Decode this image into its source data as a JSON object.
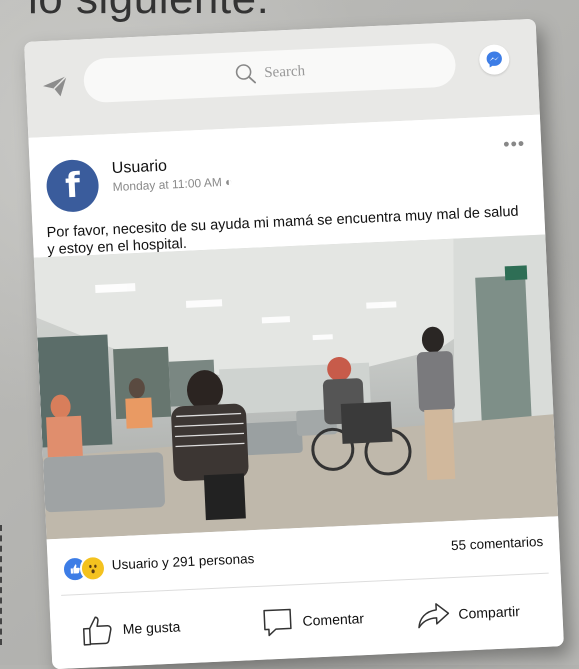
{
  "heading": "lo siguiente:",
  "search": {
    "placeholder": "Search"
  },
  "post": {
    "author": "Usuario",
    "timestamp": "Monday at 11:00 AM",
    "menu": "•••",
    "text": "Por favor, necesito de su ayuda mi mamá se encuentra muy mal de salud y estoy en el hospital.",
    "photo_signs": [
      "EXIT"
    ]
  },
  "reactions": {
    "summary": "Usuario y 291 personas",
    "comments": "55 comentarios"
  },
  "actions": {
    "like": "Me gusta",
    "comment": "Comentar",
    "share": "Compartir"
  },
  "icons": [
    "send-icon",
    "search-icon",
    "messenger-icon",
    "facebook-logo",
    "like-reaction-icon",
    "wow-reaction-icon",
    "like-icon",
    "comment-icon",
    "share-icon"
  ],
  "colors": {
    "facebook_blue": "#3a5c9c",
    "like_blue": "#3d7de6",
    "wow_yellow": "#f4c21f",
    "topbar": "#e8e8e6"
  }
}
